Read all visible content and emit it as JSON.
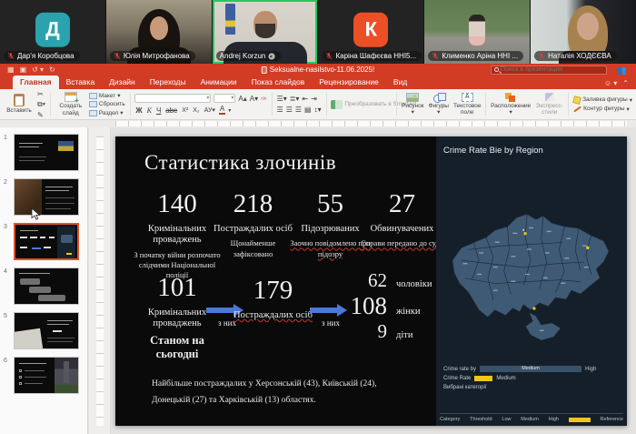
{
  "meeting": {
    "participants": [
      {
        "name": "Дар'я Коробцова",
        "muted": true,
        "type": "avatar",
        "initial": "Д",
        "avatar_color": "#2aa3ae"
      },
      {
        "name": "Юлія Митрофанова",
        "muted": true,
        "type": "video"
      },
      {
        "name": "Andrej Korzun",
        "muted": false,
        "type": "video",
        "active_speaker": true
      },
      {
        "name": "Каріна Шафєєва ННІ5...",
        "muted": true,
        "type": "avatar",
        "initial": "К",
        "avatar_color": "#ec4f26"
      },
      {
        "name": "Клименко Аріна ННІ ...",
        "muted": true,
        "type": "video"
      },
      {
        "name": "Наталія ХОДЄЄВА",
        "muted": true,
        "type": "video"
      }
    ]
  },
  "powerpoint": {
    "titlebar": {
      "document_title": "Seksualne-nasilstvo-11.06.2025!",
      "search_placeholder": "Поиск в презентации"
    },
    "tabs": [
      {
        "label": "Главная",
        "active": true
      },
      {
        "label": "Вставка"
      },
      {
        "label": "Дизайн"
      },
      {
        "label": "Переходы"
      },
      {
        "label": "Анимации"
      },
      {
        "label": "Показ слайдов"
      },
      {
        "label": "Рецензирование"
      },
      {
        "label": "Вид"
      }
    ],
    "ribbon": {
      "paste": "Вставить",
      "new_slide": "Создать слайд",
      "layout": "Макет",
      "reset": "Сбросить",
      "section": "Раздел",
      "bold": "Ж",
      "italic": "К",
      "underline": "Ч",
      "strike": "abc",
      "sup": "X²",
      "sub": "X₂",
      "font_color": "А",
      "smartart": "Преобразовать в SmartArt",
      "picture": "Рисунок",
      "shapes": "Фигуры",
      "textbox": "Текстовое поле",
      "arrange": "Расположение",
      "quick_styles": "Экспресс-стили",
      "shape_fill": "Заливка фигуры",
      "shape_outline": "Контур фигуры"
    },
    "slide_panel": {
      "slides": [
        {
          "num": "1"
        },
        {
          "num": "2"
        },
        {
          "num": "3"
        },
        {
          "num": "4"
        },
        {
          "num": "5"
        },
        {
          "num": "6"
        }
      ],
      "selected": 3
    }
  },
  "slide": {
    "title": "Статистика злочинів",
    "stats_row1": [
      {
        "value": "140",
        "label": "Кримінальних проваджень",
        "sub": "З початку війни розпочато слідчими Національної поліції"
      },
      {
        "value": "218",
        "label": "Постраждалих осіб",
        "sub": "Щонайменше зафіксовано"
      },
      {
        "value": "55",
        "label": "Підозрюваних",
        "sub": "Заочно повідомлено про підозру"
      },
      {
        "value": "27",
        "label": "Обвинувачених",
        "sub": "Справи передано до суду"
      }
    ],
    "stats_row2": {
      "cases_value": "101",
      "cases_label": "Кримінальних проваджень",
      "cases_sublabel": "Станом на сьогодні",
      "arrow1_label": "з них",
      "victims_value": "179",
      "victims_label": "Постраждалих осіб",
      "arrow2_label": "з них",
      "breakdown": [
        {
          "value": "62",
          "label": "чоловіки"
        },
        {
          "value": "108",
          "label": "жінки"
        },
        {
          "value": "9",
          "label": "діти"
        }
      ]
    },
    "footnote": "Найбільше постраждалих у Херсонській (43), Київській (24), Донецькій (27) та Харківській (13) областях."
  },
  "map_panel": {
    "title": "Crime Rate Bie by Region",
    "legend": {
      "row1_label": "Crime rate by",
      "row1_bar_text": "Medium",
      "row1_right": "High",
      "row2_label": "Crime Rate",
      "row2_value": "Medium",
      "row3_label": "Вибрані категорії"
    },
    "bottom_labels": [
      "Category",
      "Threshold",
      "Low",
      "Medium",
      "High",
      "Reference"
    ],
    "colors": {
      "background": "#141f2a",
      "region_fill": "#3f5a74",
      "highlight": "#f2c41d"
    }
  },
  "colors": {
    "ppt_red": "#d23b24",
    "active_speaker_green": "#25c760",
    "arrow_blue": "#4b79d6"
  }
}
